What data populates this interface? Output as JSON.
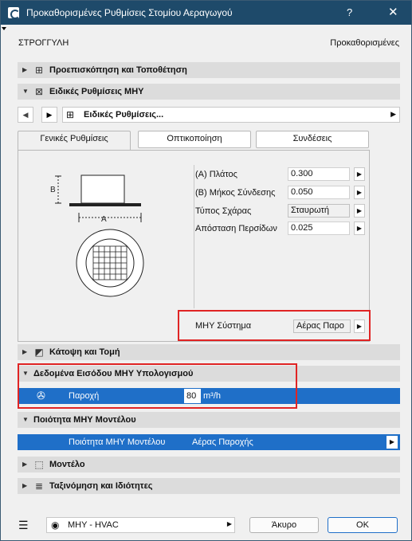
{
  "window": {
    "title": "Προκαθορισμένες Ρυθμίσεις Στομίου Αεραγωγού",
    "help_label": "?",
    "close_label": "✕"
  },
  "header": {
    "shape": "ΣΤΡΟΓΓΥΛΗ",
    "preset": "Προκαθορισμένες"
  },
  "sections": {
    "preview": "Προεπισκόπηση και Τοποθέτηση",
    "mep_settings": "Ειδικές Ρυθμίσεις ΜΗΥ",
    "floor_plan": "Κάτοψη και Τομή",
    "calc_input": "Δεδομένα Εισόδου ΜΗΥ Υπολογισμού",
    "model_quality": "Ποιότητα ΜΗΥ Μοντέλου",
    "model": "Μοντέλο",
    "classification": "Ταξινόμηση και Ιδιότητες"
  },
  "nav": {
    "selector_label": "Ειδικές Ρυθμίσεις..."
  },
  "tabs": [
    {
      "label": "Γενικές Ρυθμίσεις"
    },
    {
      "label": "Οπτικοποίηση"
    },
    {
      "label": "Συνδέσεις"
    }
  ],
  "diagram": {
    "label_a": "A",
    "label_b": "B"
  },
  "params": {
    "width_label": "(A) Πλάτος",
    "width_value": "0.300",
    "conn_length_label": "(B) Μήκος Σύνδεσης",
    "conn_length_value": "0.050",
    "grille_type_label": "Τύπος Σχάρας",
    "grille_type_value": "Σταυρωτή",
    "louver_distance_label": "Απόσταση Περσίδων",
    "louver_distance_value": "0.025",
    "mep_system_label": "ΜΗΥ Σύστημα",
    "mep_system_value": "Αέρας Παρο"
  },
  "flow": {
    "label": "Παροχή",
    "value": "80",
    "unit": "m³/h"
  },
  "quality_row": {
    "label": "Ποιότητα ΜΗΥ Μοντέλου",
    "value": "Αέρας Παροχής"
  },
  "footer": {
    "layer_value": "ΜΗΥ - HVAC",
    "cancel_label": "Άκυρο",
    "ok_label": "OK"
  },
  "colors": {
    "titlebar": "#1e4a6a",
    "selection": "#1f6fc8",
    "highlight": "#e02424"
  }
}
